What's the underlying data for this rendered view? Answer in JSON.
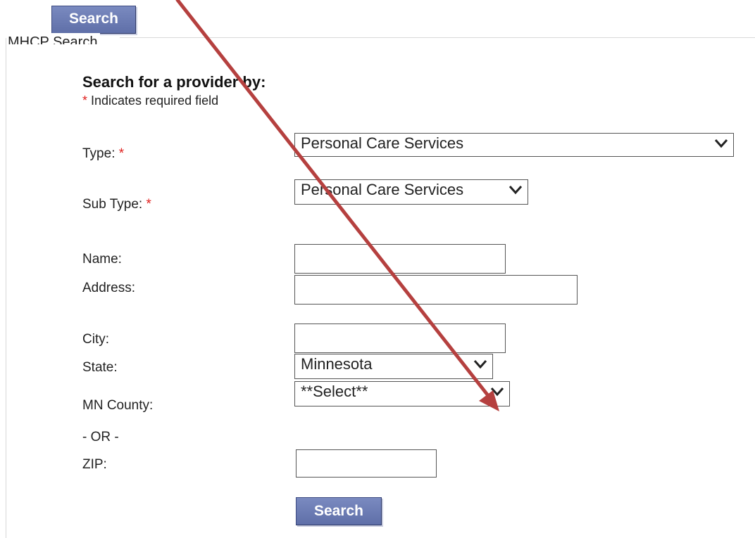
{
  "top_tab": {
    "label": "Search"
  },
  "fieldset": {
    "legend": "MHCP Search"
  },
  "form": {
    "heading": "Search for a provider by:",
    "required_star": "*",
    "required_note": " Indicates required field",
    "type": {
      "label": "Type: ",
      "star": "*",
      "selected": "Personal Care Services"
    },
    "sub_type": {
      "label": "Sub Type: ",
      "star": "*",
      "selected": "Personal Care Services"
    },
    "name": {
      "label": "Name:",
      "value": ""
    },
    "address": {
      "label": "Address:",
      "value": ""
    },
    "city": {
      "label": "City:",
      "value": ""
    },
    "state": {
      "label": "State:",
      "selected": "Minnesota"
    },
    "county": {
      "label": "MN County:",
      "selected": "**Select**"
    },
    "or_divider": "- OR -",
    "zip": {
      "label": "ZIP:",
      "value": ""
    },
    "search_button": "Search"
  },
  "annotation": {
    "arrow_color": "#b5403f",
    "icon": "arrow-annotation-icon"
  },
  "colors": {
    "button_bg": "#6a7ab5",
    "required": "#e0201e"
  }
}
